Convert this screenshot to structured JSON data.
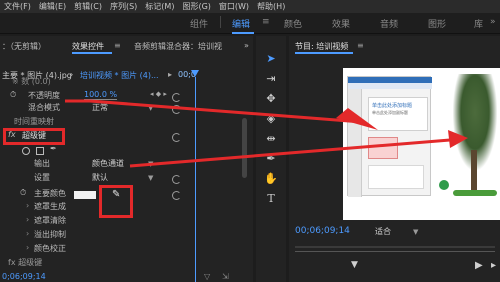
{
  "menu": [
    "文件(F)",
    "编辑(E)",
    "剪辑(C)",
    "序列(S)",
    "标记(M)",
    "图形(G)",
    "窗口(W)",
    "帮助(H)"
  ],
  "workspace": {
    "tabs": [
      "组件",
      "编辑",
      "颜色",
      "效果",
      "音频",
      "图形",
      "库"
    ],
    "more": "»"
  },
  "left": {
    "tab_source": "：（无剪辑）",
    "tab_effect_controls": "效果控件",
    "tab_audio_mixer": "音频剪辑混合器：培训视",
    "tab_more": "»",
    "clip_master": "主要 * 图片 (4).jpg",
    "clip_seq": "培训视频 * 图片 (4)...",
    "timeline_time": "00;0",
    "bottom_time": "0;06;09;14",
    "rows": {
      "r0": "※ 数 (0.0)",
      "opacity_label": "不透明度",
      "opacity_value": "100.0 %",
      "blend_label": "混合模式",
      "blend_value": "正常",
      "remap_label": "时间重映射",
      "fx_label": "fx",
      "key_label": "超级键",
      "output_label": "输出",
      "output_value": "颜色通道",
      "settings_label": "设置",
      "settings_value": "默认",
      "keycolor_label": "主要颜色",
      "m1": "遮罩生成",
      "m2": "遮罩清除",
      "m3": "溢出抑制",
      "m4": "颜色校正",
      "last": "fx 超级键"
    }
  },
  "program": {
    "title": "节目: 培训视频",
    "timecode": "00;06;09;14",
    "fit": "适合",
    "slide_heading": "单击此处添加标题",
    "slide_sub": "单击此处添加副标题"
  },
  "colors": {
    "accent": "#4d9bff",
    "annotation": "#e3292a"
  }
}
